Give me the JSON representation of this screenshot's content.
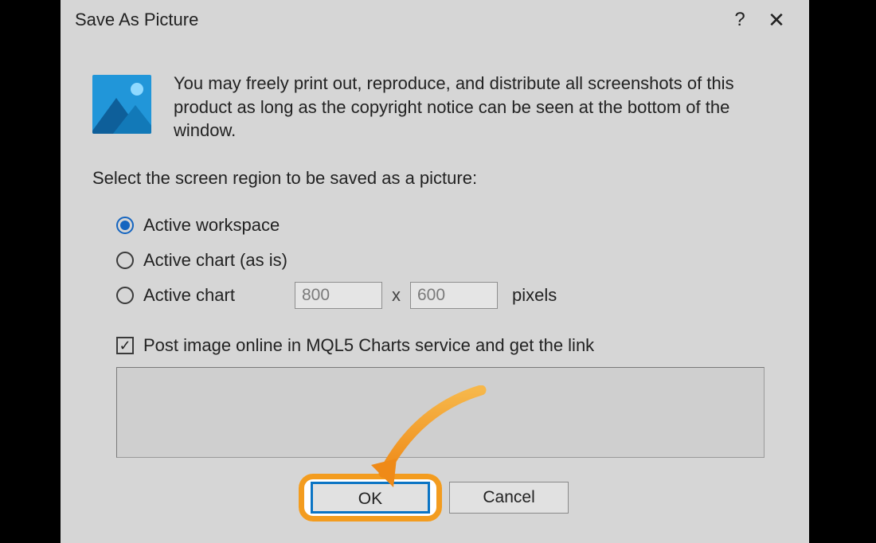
{
  "titlebar": {
    "title": "Save As Picture",
    "help_label": "?",
    "close_label": "✕"
  },
  "intro": {
    "text": "You may freely print out, reproduce, and distribute all screenshots of this product as long as the copyright notice can be seen at the bottom of the window."
  },
  "prompt": "Select the screen region to be saved as a picture:",
  "options": {
    "workspace": "Active workspace",
    "chart_asis": "Active chart (as is)",
    "chart_custom": "Active chart",
    "width": "800",
    "height": "600",
    "sep": "x",
    "suffix": "pixels"
  },
  "checkbox": {
    "label": "Post image online in MQL5 Charts service and get the link",
    "checked_glyph": "✓"
  },
  "buttons": {
    "ok": "OK",
    "cancel": "Cancel"
  },
  "colors": {
    "highlight": "#f39c1f"
  }
}
